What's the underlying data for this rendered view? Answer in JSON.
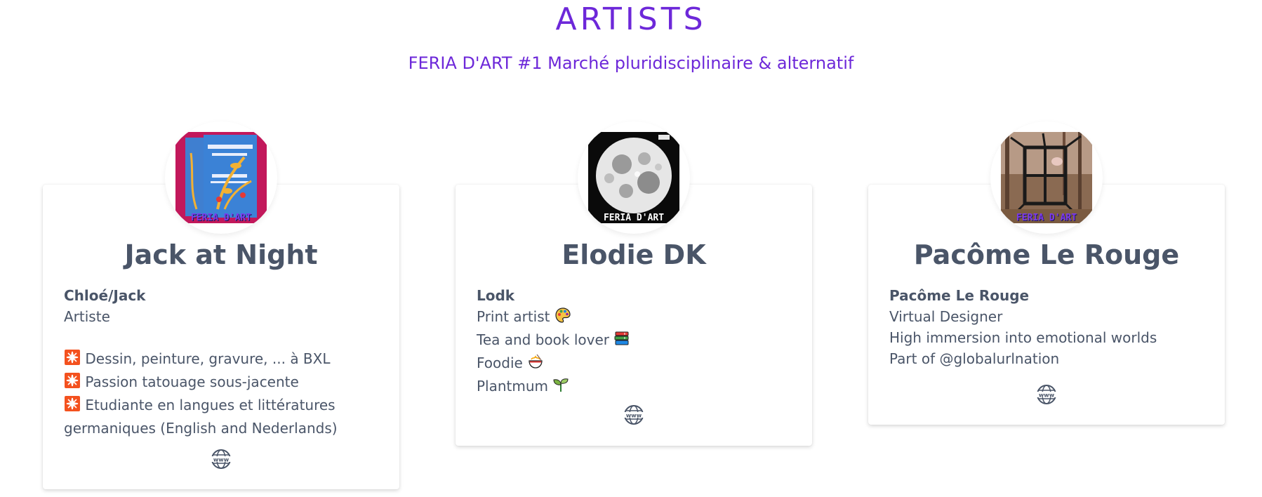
{
  "header": {
    "title": "ARTISTS",
    "subtitle": "FERIA D'ART #1 Marché pluridisciplinaire & alternatif"
  },
  "avatar_logo_text": "FERIA D'ART",
  "colors": {
    "accent": "#6d28d9",
    "text": "#4a5568"
  },
  "artists": [
    {
      "name": "Jack at Night",
      "handle": "Chloé/Jack",
      "lines": [
        "Artiste",
        "",
        "Dessin, peinture, gravure, ... à BXL",
        "Passion tatouage sous-jacente",
        "Etudiante en langues et littératures",
        "germaniques (English and Nederlands)"
      ],
      "icons": [
        "orange-star-icon"
      ],
      "link_icon": "www-globe-icon"
    },
    {
      "name": "Elodie DK",
      "handle": "Lodk",
      "lines": [
        "Print artist",
        "Tea and book lover",
        "Foodie",
        "Plantmum"
      ],
      "icons": [
        "palette-icon",
        "books-icon",
        "bowl-icon",
        "seedling-icon"
      ],
      "link_icon": "www-globe-icon"
    },
    {
      "name": "Pacôme Le Rouge",
      "handle": "Pacôme Le Rouge",
      "lines": [
        "Virtual Designer",
        "High immersion into emotional worlds",
        "Part of @globalurlnation"
      ],
      "icons": [],
      "link_icon": "www-globe-icon"
    }
  ]
}
